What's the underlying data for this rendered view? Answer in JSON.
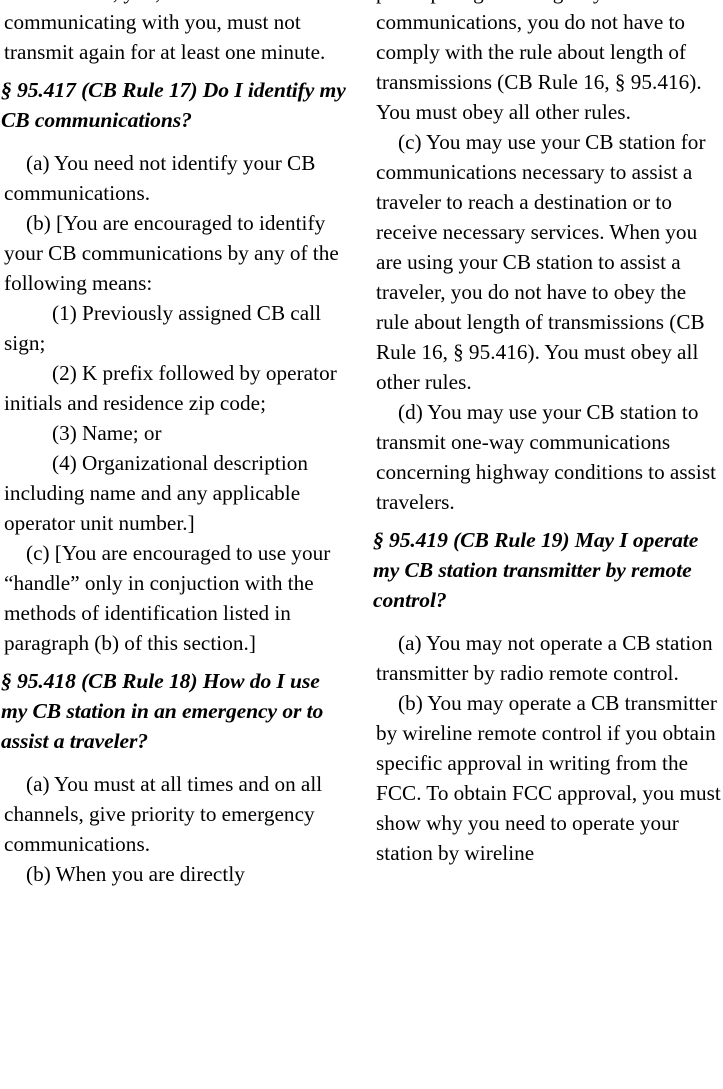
{
  "document": {
    "kind": "scanned-regulation-page",
    "layout": "two-column",
    "background_color": "#ffffff",
    "text_color": "#000000"
  },
  "left_column": {
    "blocks": [
      {
        "type": "paragraph-continuation",
        "text": "conversation, you, and the stations communicating with you, must not transmit again for at least one minute."
      },
      {
        "type": "heading",
        "text": "§ 95.417 (CB Rule 17) Do I identify my CB communications?"
      },
      {
        "type": "paragraph",
        "text": "(a) You need not identify your CB communications."
      },
      {
        "type": "paragraph",
        "text": "(b) [You are encouraged to identify your CB communications by any of the following means:"
      },
      {
        "type": "sub-paragraph",
        "text": "(1) Previously assigned CB call sign;"
      },
      {
        "type": "sub-paragraph",
        "text": "(2) K prefix followed by operator initials and residence zip code;"
      },
      {
        "type": "sub-paragraph",
        "text": "(3) Name; or"
      },
      {
        "type": "sub-paragraph",
        "text": "(4) Organizational description including name and any applicable operator unit number.]"
      },
      {
        "type": "paragraph",
        "text": "(c) [You are encouraged to use your “handle” only in conjuction with the methods of identification listed in paragraph (b) of this section.]"
      },
      {
        "type": "heading",
        "text": "§ 95.418 (CB Rule 18) How do I use my CB station in an emergency or to assist a traveler?"
      },
      {
        "type": "paragraph",
        "text": "(a) You must at all times and on all channels, give priority to emergency communications."
      },
      {
        "type": "paragraph",
        "text": "(b) When you are directly"
      }
    ]
  },
  "right_column": {
    "blocks": [
      {
        "type": "paragraph-continuation",
        "text": "participating in emergency communications, you do not have to comply with the rule about length of transmissions (CB Rule 16, § 95.416). You must obey all other rules."
      },
      {
        "type": "paragraph",
        "text": "(c) You may use your CB station for communications necessary to assist a traveler to reach a destination or to receive necessary services. When you are using your CB station to assist a traveler, you do not have to obey the rule about length of transmissions (CB Rule 16, § 95.416). You must obey all other rules."
      },
      {
        "type": "paragraph",
        "text": "(d) You may use your CB station to transmit one-way communications concerning highway conditions to assist travelers."
      },
      {
        "type": "heading",
        "text": "§ 95.419 (CB Rule 19) May I operate my CB station transmitter by remote control?"
      },
      {
        "type": "paragraph",
        "text": "(a) You may not operate a CB station transmitter by radio remote control."
      },
      {
        "type": "paragraph",
        "text": "(b) You may operate a CB transmitter by wireline remote control if you obtain specific approval in writing from the FCC. To obtain FCC approval, you must show why you need to operate your station by wireline"
      }
    ]
  }
}
